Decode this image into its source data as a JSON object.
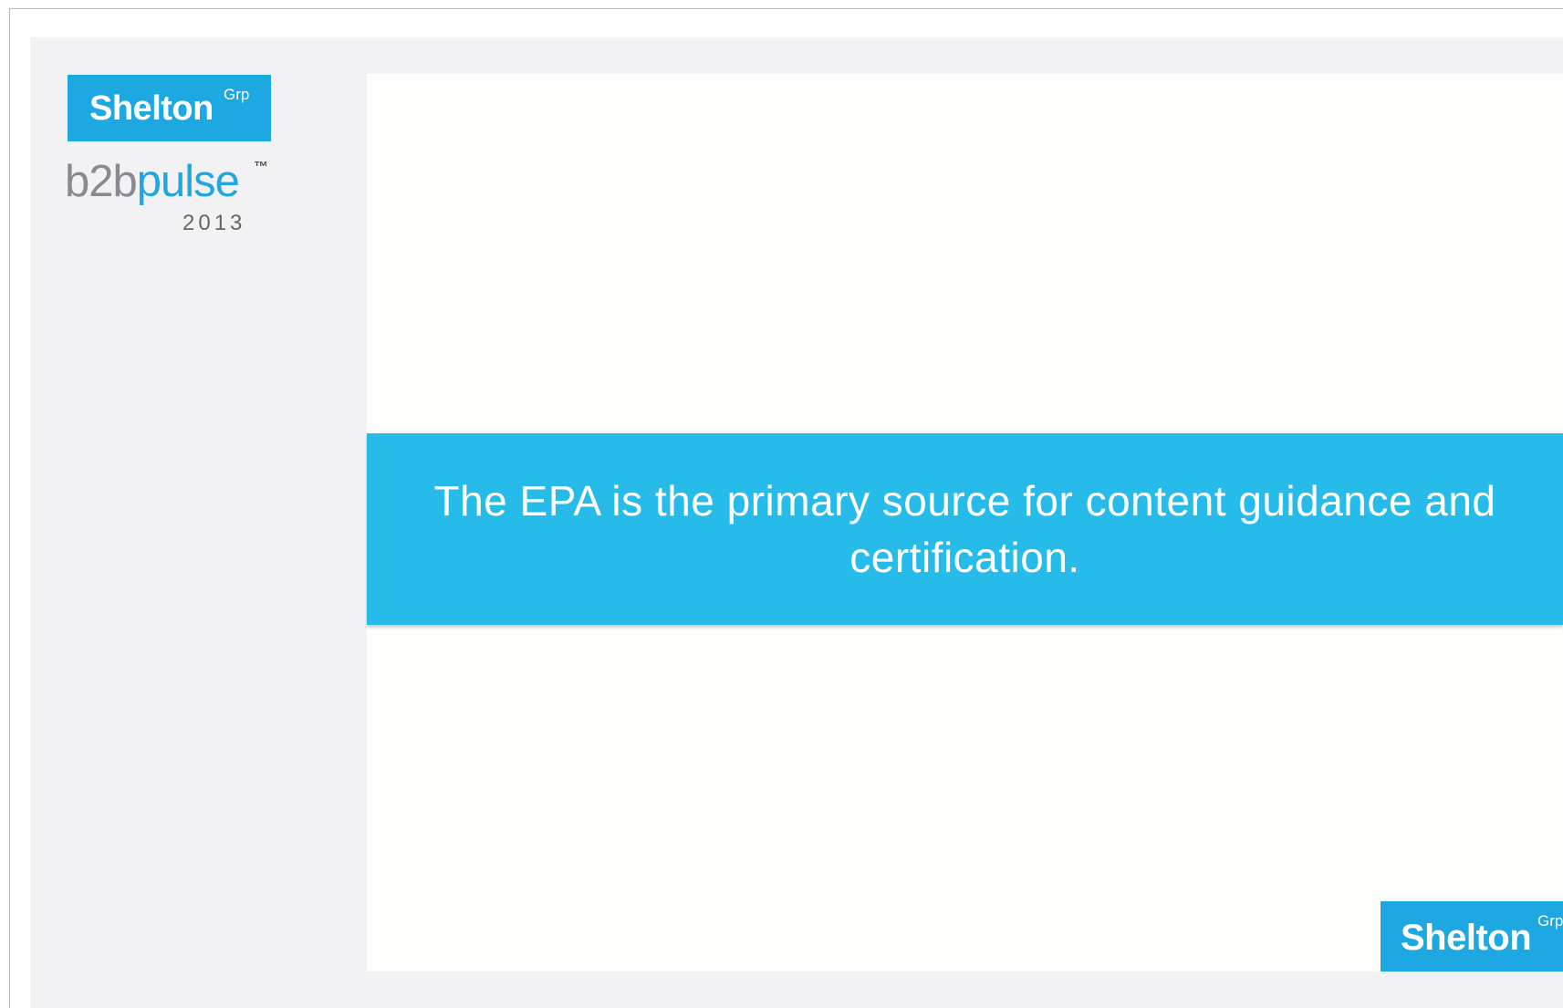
{
  "branding": {
    "company_name": "Shelton",
    "company_suffix": "Grp",
    "product_name_part1": "b2b",
    "product_name_part2": "pulse",
    "trademark": "™",
    "year": "2013"
  },
  "slide": {
    "quote": "The EPA is the primary source for content guidance and certification."
  },
  "footer": {
    "company_name": "Shelton",
    "company_suffix": "Grp"
  },
  "colors": {
    "brand_blue": "#1ea8e1",
    "band_blue": "#27bbea",
    "sidebar_bg": "#f2f2f4",
    "panel_bg": "#fdfdfb"
  }
}
